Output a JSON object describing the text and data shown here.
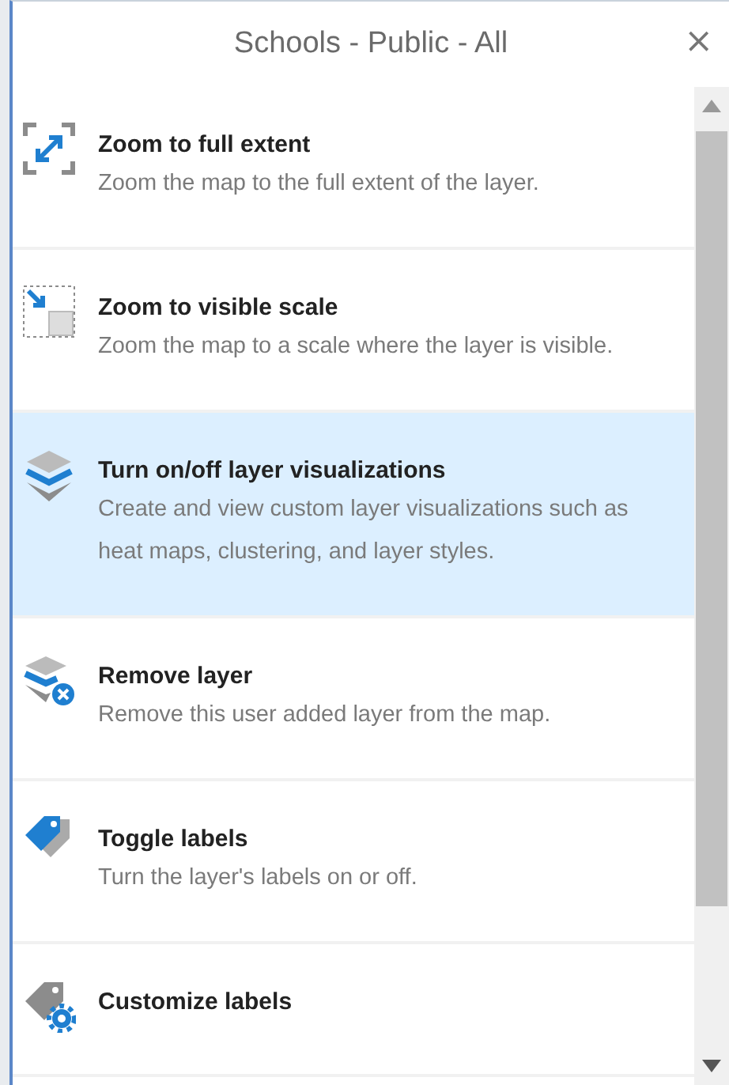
{
  "panel": {
    "title": "Schools - Public - All",
    "close": "×"
  },
  "actions": [
    {
      "title": "Zoom to full extent",
      "description": "Zoom the map to the full extent of the layer.",
      "selected": false
    },
    {
      "title": "Zoom to visible scale",
      "description": "Zoom the map to a scale where the layer is visible.",
      "selected": false
    },
    {
      "title": "Turn on/off layer visualizations",
      "description": "Create and view custom layer visualizations such as heat maps, clustering, and layer styles.",
      "selected": true
    },
    {
      "title": "Remove layer",
      "description": "Remove this user added layer from the map.",
      "selected": false
    },
    {
      "title": "Toggle labels",
      "description": "Turn the layer's labels on or off.",
      "selected": false
    },
    {
      "title": "Customize labels",
      "selected": false
    }
  ]
}
